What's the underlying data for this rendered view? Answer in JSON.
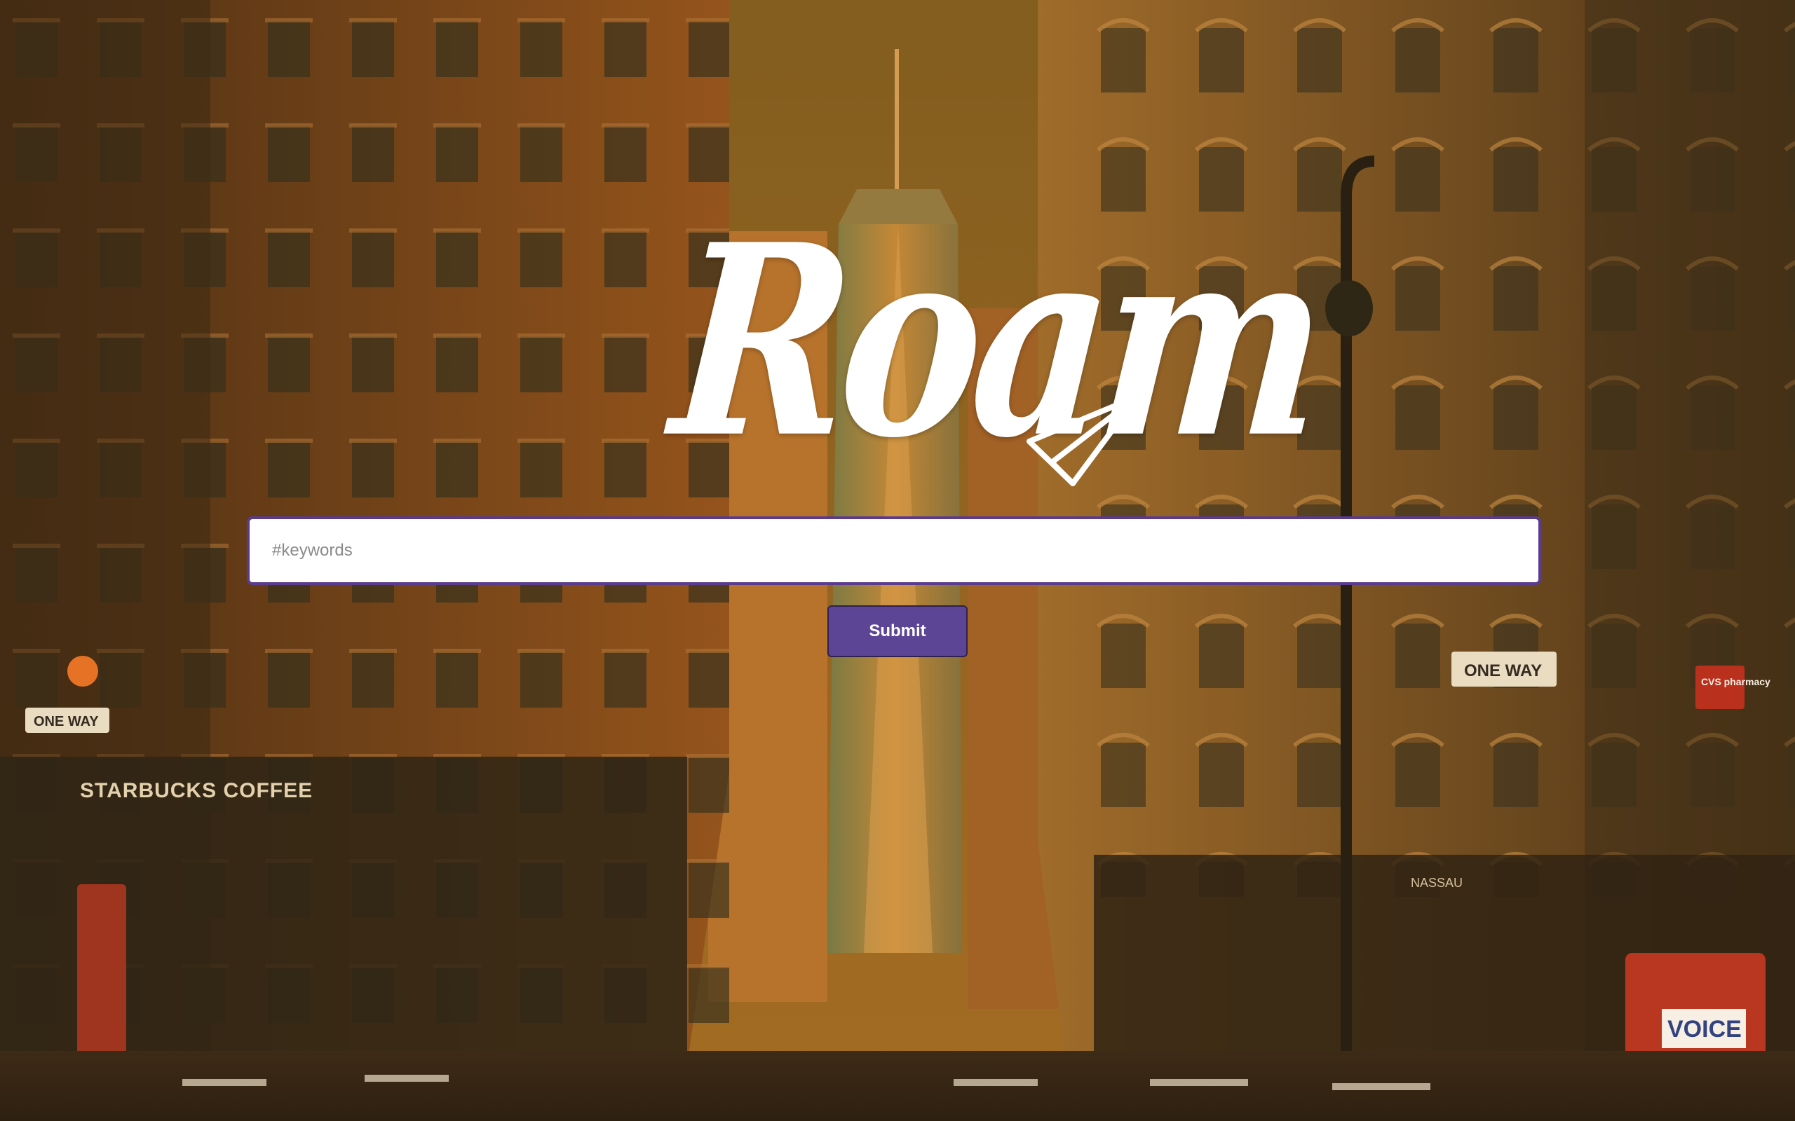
{
  "logo": {
    "text": "Roam",
    "icon": "paper-plane-icon"
  },
  "search": {
    "placeholder": "#keywords",
    "value": ""
  },
  "submit": {
    "label": "Submit"
  },
  "colors": {
    "accent": "#5d4596",
    "input_border": "#5b3b8c",
    "logo": "#ffffff",
    "background_tint": "#8a5a1c"
  },
  "background": {
    "signs": {
      "starbucks": "STARBUCKS COFFEE",
      "one_way_left": "ONE WAY",
      "one_way_right": "ONE WAY",
      "cvs": "CVS pharmacy",
      "voice": "VOICE",
      "nassau": "NASSAU"
    }
  }
}
